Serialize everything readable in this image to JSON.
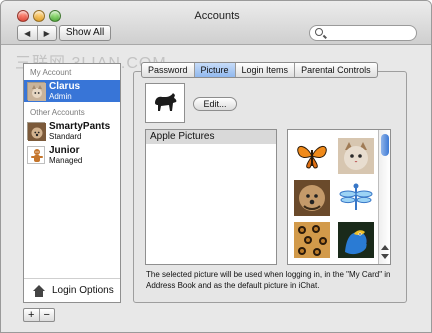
{
  "window": {
    "title": "Accounts",
    "toolbar": {
      "show_all_label": "Show All",
      "back_glyph": "◀",
      "forward_glyph": "▶",
      "search_placeholder": ""
    },
    "watermark": "三联网 3LIAN.COM"
  },
  "sidebar": {
    "sections": [
      {
        "heading": "My Account",
        "accounts": [
          {
            "name": "Clarus",
            "role": "Admin",
            "selected": true,
            "icon": "cat-avatar-icon"
          }
        ]
      },
      {
        "heading": "Other Accounts",
        "accounts": [
          {
            "name": "SmartyPants",
            "role": "Standard",
            "selected": false,
            "icon": "dog-avatar-icon"
          },
          {
            "name": "Junior",
            "role": "Managed",
            "selected": false,
            "icon": "gingerbread-avatar-icon"
          }
        ]
      }
    ],
    "login_options_label": "Login Options",
    "add_label": "+",
    "remove_label": "−"
  },
  "tabs": [
    "Password",
    "Picture",
    "Login Items",
    "Parental Controls"
  ],
  "active_tab": "Picture",
  "picture_tab": {
    "edit_label": "Edit...",
    "current_picture_icon": "dog-silhouette-icon",
    "list": {
      "items": [
        "Apple Pictures"
      ],
      "selected": "Apple Pictures"
    },
    "thumbnails": [
      "butterfly-icon",
      "cat-icon",
      "dog-icon",
      "dragonfly-icon",
      "leopard-fur-icon",
      "parrot-icon"
    ],
    "description": "The selected picture will be used when logging in, in the \"My Card\" in Address Book and as the default picture in iChat."
  },
  "colors": {
    "selection_blue": "#3875d7",
    "window_bg": "#e8e8e8",
    "tab_active": "#91b8ee"
  }
}
